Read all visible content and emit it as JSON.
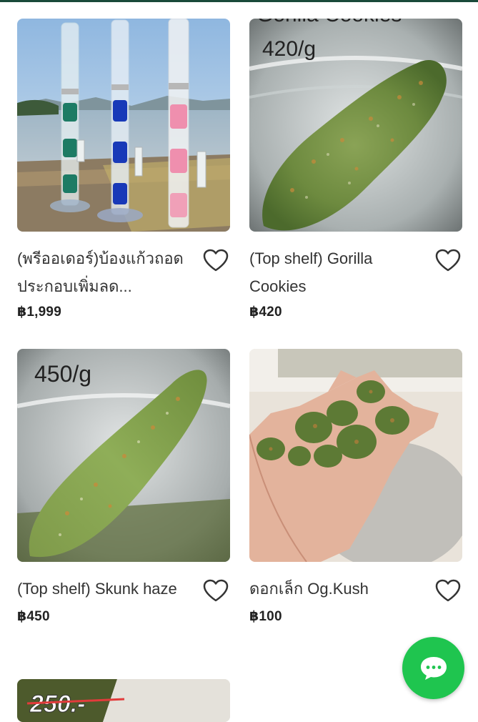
{
  "products": [
    {
      "title": "(พรีออเดอร์)บ้องแก้วถอดประกอบเพิ่มลด...",
      "price": "฿1,999",
      "image_overlay": "",
      "image": "glass-bongs-lakeside"
    },
    {
      "title": "(Top shelf) Gorilla Cookies",
      "price": "฿420",
      "image_overlay": "420/g",
      "image_top_text": "Gorilla Cookies",
      "image": "bud-in-jar"
    },
    {
      "title": "(Top shelf) Skunk haze",
      "price": "฿450",
      "image_overlay": "450/g",
      "image": "bud-in-jar"
    },
    {
      "title": "ดอกเล็ก Og.Kush",
      "price": "฿100",
      "image_overlay": "",
      "image": "buds-in-hand"
    },
    {
      "title": "",
      "price": "",
      "image_overlay": "250.-",
      "image": "bud-partial"
    }
  ],
  "icons": {
    "favorite": "heart-outline-icon",
    "chat": "chat-bubble-icon"
  },
  "colors": {
    "chat_fab": "#1fc54f",
    "price_text": "#222222"
  }
}
